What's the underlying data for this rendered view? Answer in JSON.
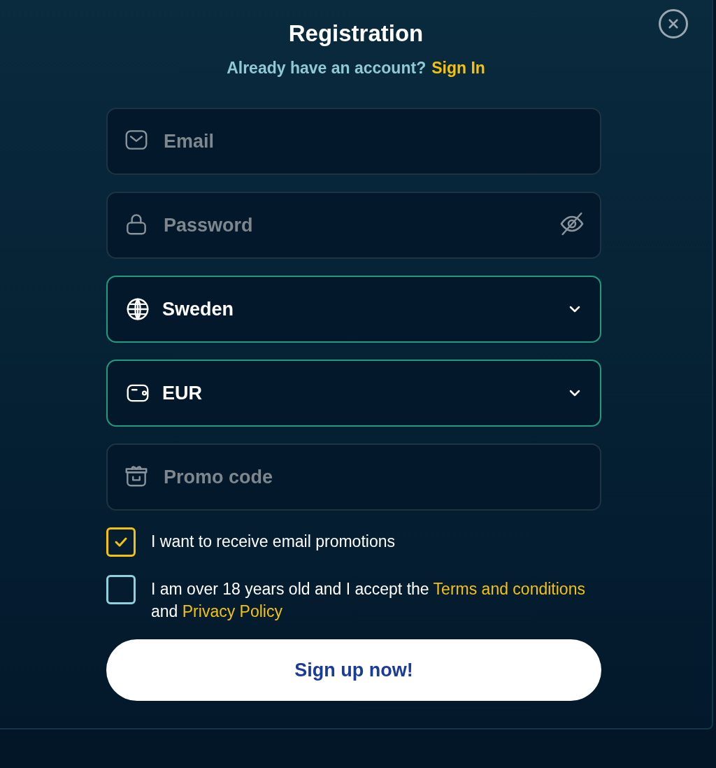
{
  "dialog": {
    "title": "Registration",
    "subtitle": "Already have an account?",
    "sign_in_link": "Sign In"
  },
  "fields": [
    {
      "kind": "email",
      "placeholder": "Email"
    },
    {
      "kind": "password",
      "placeholder": "Password"
    },
    {
      "kind": "country",
      "value": "Sweden"
    },
    {
      "kind": "currency",
      "value": "EUR"
    },
    {
      "kind": "promo",
      "placeholder": "Promo code"
    }
  ],
  "consents": [
    {
      "checked": true,
      "parts": [
        {
          "kind": "plain",
          "text": "I want to receive email promotions"
        }
      ]
    },
    {
      "checked": false,
      "parts": [
        {
          "kind": "plain",
          "text": "I am over 18 years old and I accept the "
        },
        {
          "kind": "link",
          "text": "Terms and conditions"
        },
        {
          "kind": "plain",
          "text": " and "
        },
        {
          "kind": "link",
          "text": "Privacy Policy"
        }
      ]
    }
  ],
  "submit_button": "Sign up now!"
}
